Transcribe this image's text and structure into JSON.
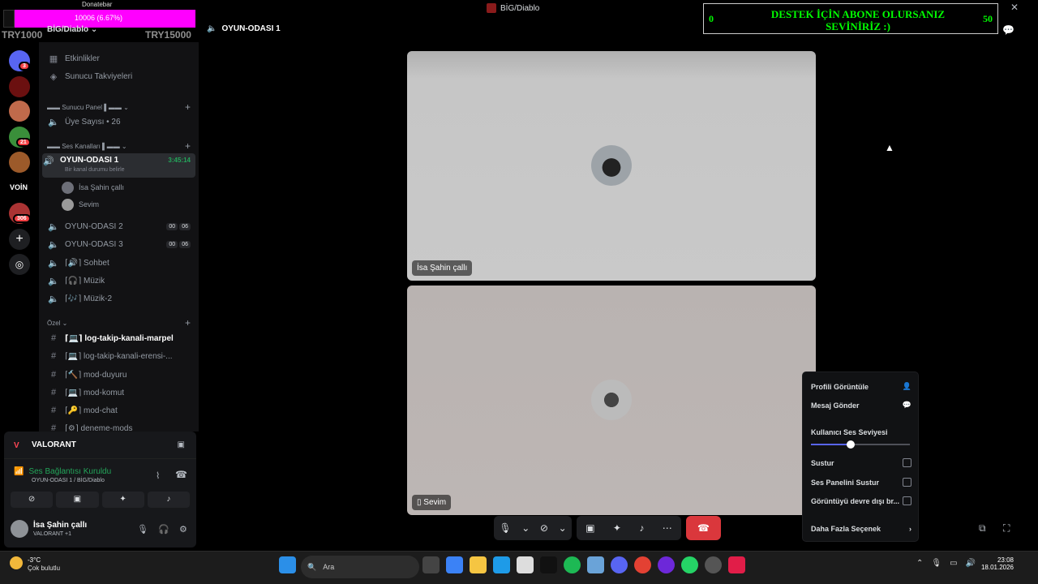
{
  "window": {
    "title": "BİG/Diablo"
  },
  "overlay_donate": {
    "label": "Donatebar",
    "progress_text": "10006 (6.67%)",
    "progress": 0.0667,
    "left_amount": "TRY1000",
    "right_amount": "TRY15000"
  },
  "overlay_support": {
    "message": "DESTEK İÇİN ABONE OLURSANIZ SEVİNİRİZ :)",
    "left_value": "0",
    "right_value": "50"
  },
  "server": {
    "name": "BİG/Diablo"
  },
  "rail": {
    "badges": [
      "3",
      "21",
      "306"
    ],
    "label": "VOİN"
  },
  "sidebar": {
    "top_items": [
      {
        "label": "Etkinlikler",
        "icon": "calendar-icon"
      },
      {
        "label": "Sunucu Takviyeleri",
        "icon": "boost-icon"
      }
    ],
    "category_panel": "▬▬ Sunucu Panel ▌▬▬",
    "member_count": "Üye Sayısı • 26",
    "category_voice": "▬▬ Ses Kanalları ▌▬▬",
    "active_channel": {
      "name": "OYUN-ODASI 1",
      "timer": "3:45:14",
      "status": "Bir kanal durumu belirle"
    },
    "members": [
      "İsa Şahin çallı",
      "Sevim"
    ],
    "voice_channels": [
      {
        "name": "OYUN-ODASI 2",
        "a": "00",
        "b": "06"
      },
      {
        "name": "OYUN-ODASI 3",
        "a": "00",
        "b": "06"
      },
      {
        "name": "⌈🔊⌉ Sohbet"
      },
      {
        "name": "⌈🎧⌉ Müzik"
      },
      {
        "name": "⌈🎶⌉ Müzik-2"
      }
    ],
    "category_private": "Özel",
    "text_channels": [
      {
        "name": "⌈💻⌉ log-takip-kanali-marpel",
        "bright": true
      },
      {
        "name": "⌈💻⌉ log-takip-kanali-erensi-..."
      },
      {
        "name": "⌈🔨⌉ mod-duyuru"
      },
      {
        "name": "⌈💻⌉ mod-komut"
      },
      {
        "name": "⌈🔑⌉ mod-chat"
      },
      {
        "name": "⌈⚙⌉ deneme-mods"
      }
    ]
  },
  "panel": {
    "activity": "VALORANT",
    "voice_status": "Ses Bağlantısı Kuruldu",
    "voice_sub": "OYUN-ODASI 1 / BİG/Diablo",
    "user_name": "İsa Şahin çallı",
    "user_status": "VALORANT +1"
  },
  "main": {
    "channel": "OYUN-ODASI 1",
    "tiles": [
      {
        "name": "İsa Şahin çallı"
      },
      {
        "name": "Sevim"
      }
    ]
  },
  "context_menu": {
    "view_profile": "Profili Görüntüle",
    "send_message": "Mesaj Gönder",
    "volume_label": "Kullanıcı Ses Seviyesi",
    "volume": 0.4,
    "mute": "Sustur",
    "mute_soundboard": "Ses Panelini Sustur",
    "disable_video": "Görüntüyü devre dışı br...",
    "more_options": "Daha Fazla Seçenek"
  },
  "taskbar": {
    "temperature": "-3°C",
    "weather": "Çok bulutlu",
    "search_placeholder": "Ara",
    "time": "23:08",
    "date": "18.01.2026"
  },
  "colors": {
    "accent": "#5865f2",
    "online": "#23a55a",
    "danger": "#da373c",
    "donate": "#ff00ff",
    "support_text": "#00ff00"
  }
}
